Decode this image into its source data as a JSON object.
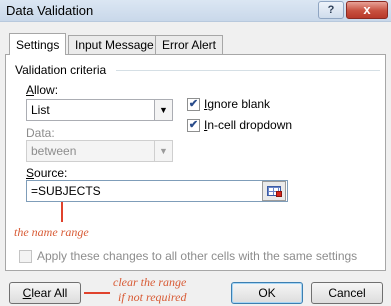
{
  "window": {
    "title": "Data Validation",
    "help_glyph": "?",
    "close_glyph": "x"
  },
  "tabs": [
    {
      "label": "Settings",
      "active": true
    },
    {
      "label": "Input Message",
      "active": false
    },
    {
      "label": "Error Alert",
      "active": false
    }
  ],
  "settings": {
    "group_label": "Validation criteria",
    "allow": {
      "label_prefix": "",
      "label_accel": "A",
      "label_rest": "llow:",
      "value": "List"
    },
    "data": {
      "label": "Data:",
      "value": "between",
      "disabled": true
    },
    "ignore_blank": {
      "label_prefix": "",
      "label_accel": "I",
      "label_rest": "gnore blank",
      "checked": true
    },
    "in_cell_dropdown": {
      "label_prefix": "",
      "label_accel": "I",
      "label_rest": "n-cell dropdown",
      "checked": true
    },
    "source": {
      "label_prefix": "",
      "label_accel": "S",
      "label_rest": "ource:",
      "value": "=SUBJECTS"
    },
    "apply_all": {
      "label": "Apply these changes to all other cells with the same settings",
      "checked": false,
      "disabled": true
    }
  },
  "annotations": {
    "name_range": "the name range",
    "clear_line1": "clear the range",
    "clear_line2": "if not required"
  },
  "buttons": {
    "clear_prefix": "",
    "clear_accel": "C",
    "clear_rest": "lear All",
    "ok": "OK",
    "cancel": "Cancel"
  },
  "icons": {
    "dropdown": "chevron-down-icon",
    "check": "checkmark-icon",
    "range_select": "range-selector-icon"
  },
  "colors": {
    "annotation": "#d85a34",
    "annotation_line": "#e0422c",
    "close_button": "#c7503f",
    "titlebar": "#c9d8ea"
  }
}
